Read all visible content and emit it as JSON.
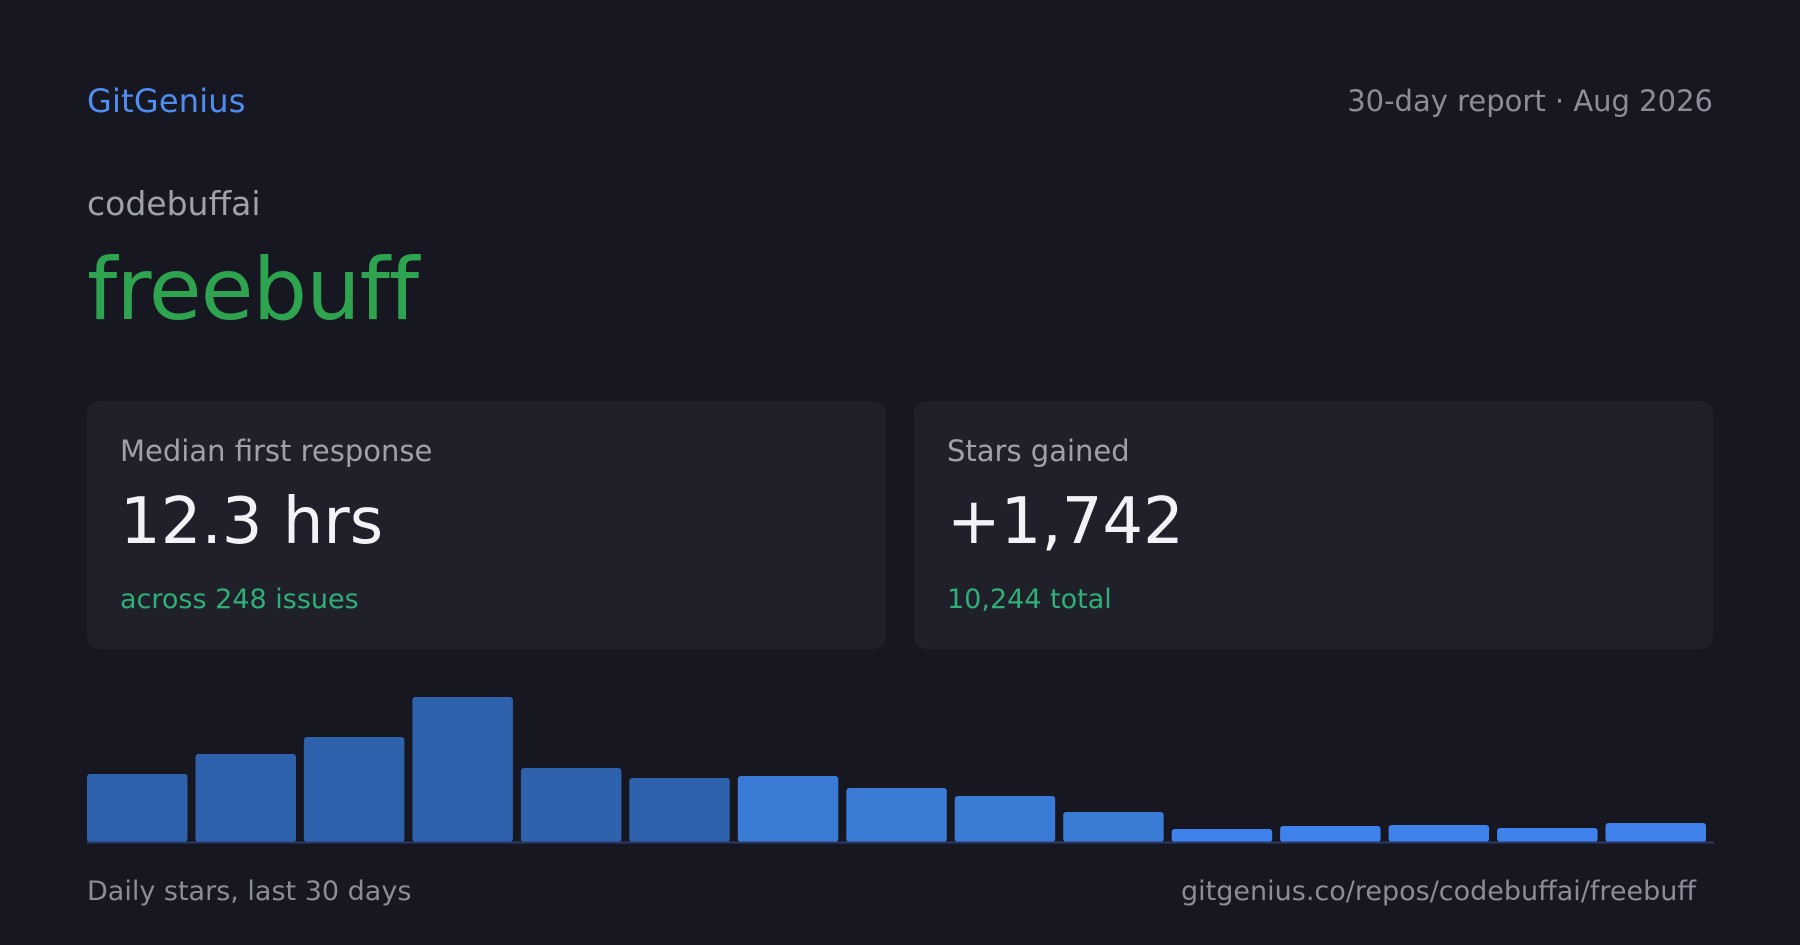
{
  "header": {
    "brand": "GitGenius",
    "report_label": "30-day report · Aug 2026"
  },
  "repo": {
    "owner": "codebuffai",
    "name": "freebuff"
  },
  "cards": {
    "response": {
      "label": "Median first response",
      "value": "12.3 hrs",
      "sub": "across 248 issues"
    },
    "stars": {
      "label": "Stars gained",
      "value": "+1,742",
      "sub": "10,244 total"
    }
  },
  "footer": {
    "caption": "Daily stars, last 30 days",
    "url": "gitgenius.co/repos/codebuffai/freebuff"
  },
  "colors": {
    "bar_past": "#2f62ad",
    "bar_mid": "#3a7bd5",
    "bar_recent": "#3f82ec"
  },
  "chart_data": {
    "type": "bar",
    "values": [
      68,
      88,
      105,
      145,
      74,
      64,
      66,
      54,
      46,
      30,
      13,
      16,
      17,
      14,
      19
    ],
    "color_groups": [
      "past",
      "past",
      "past",
      "past",
      "past",
      "past",
      "mid",
      "mid",
      "mid",
      "mid",
      "recent",
      "recent",
      "recent",
      "recent",
      "recent"
    ],
    "ylim": [
      0,
      145
    ],
    "grid": false,
    "legend": "none"
  }
}
